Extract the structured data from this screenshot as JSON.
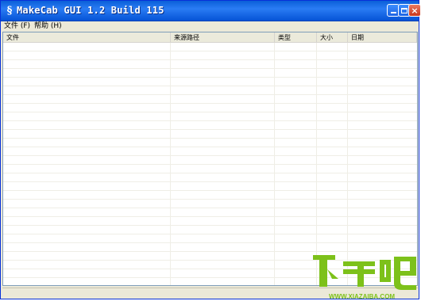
{
  "window": {
    "title": "MakeCab GUI 1.2 Build 115",
    "app_icon_glyph": "§"
  },
  "menu": {
    "items": [
      "文件 (F)",
      "帮助 (H)"
    ]
  },
  "list": {
    "columns": [
      "文件",
      "来源路径",
      "类型",
      "大小",
      "日期"
    ],
    "rows": []
  },
  "watermark": {
    "brand": "下载吧",
    "url": "WWW.XIAZAIBA.COM"
  },
  "colors": {
    "titlebar": "#0a5fd8",
    "close_button": "#c9371b",
    "watermark_green": "#7dc11a"
  }
}
